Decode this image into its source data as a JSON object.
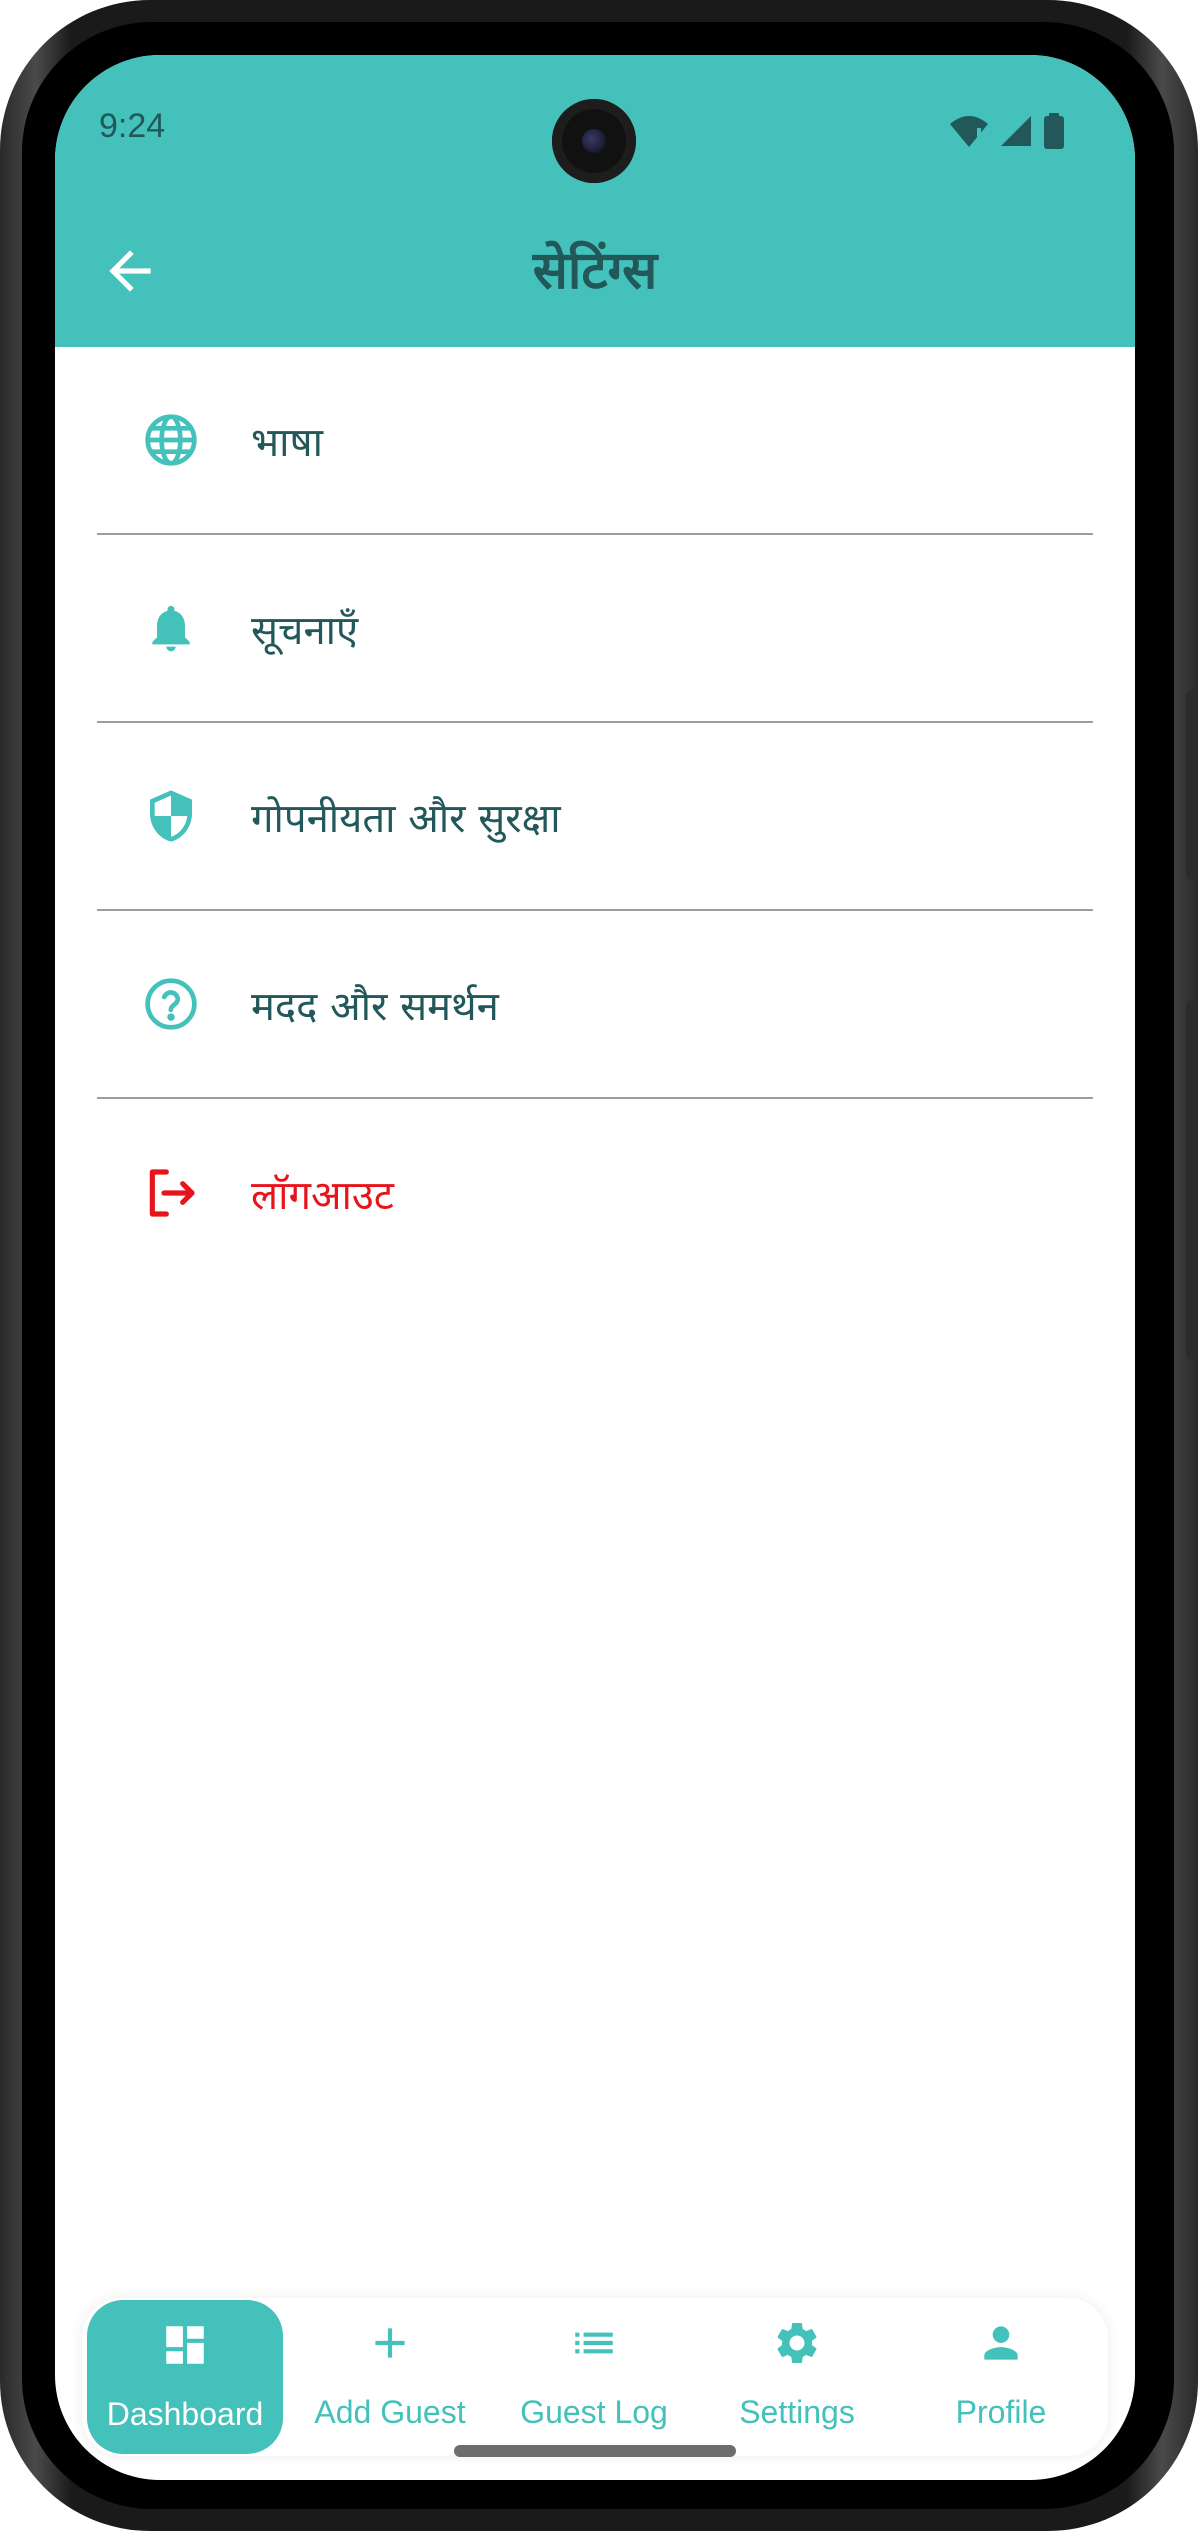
{
  "status_bar": {
    "time": "9:24"
  },
  "app_bar": {
    "title": "सेटिंग्स"
  },
  "settings": {
    "items": [
      {
        "label": "भाषा",
        "icon": "globe-icon"
      },
      {
        "label": "सूचनाएँ",
        "icon": "bell-icon"
      },
      {
        "label": "गोपनीयता और सुरक्षा",
        "icon": "shield-icon"
      },
      {
        "label": "मदद और समर्थन",
        "icon": "help-circle-icon"
      },
      {
        "label": "लॉगआउट",
        "icon": "logout-icon"
      }
    ]
  },
  "bottom_nav": {
    "items": [
      {
        "label": "Dashboard",
        "icon": "dashboard-icon",
        "active": true
      },
      {
        "label": "Add Guest",
        "icon": "plus-icon"
      },
      {
        "label": "Guest Log",
        "icon": "list-icon"
      },
      {
        "label": "Settings",
        "icon": "gear-icon"
      },
      {
        "label": "Profile",
        "icon": "person-icon"
      }
    ]
  },
  "colors": {
    "accent": "#43c1ba",
    "text": "#22585a",
    "danger": "#e8141c",
    "divider": "#9e9e9e"
  }
}
